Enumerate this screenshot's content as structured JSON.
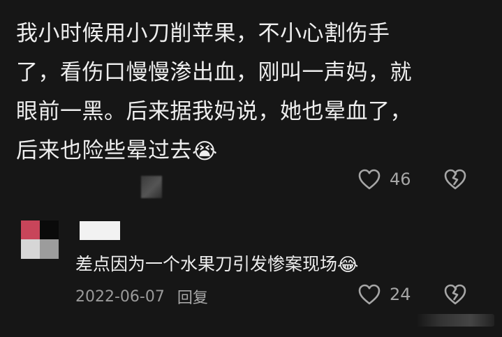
{
  "main_comment": {
    "lines": [
      "我小时候用小刀削苹果，不小心割伤手",
      "了，看伤口慢慢渗出血，刚叫一声妈，就",
      "眼前一黑。后来据我妈说，她也晕血了，",
      "后来也险些晕过去"
    ],
    "emoji": "😭",
    "like_count": "46"
  },
  "reply": {
    "text": "差点因为一个水果刀引发惨案现场",
    "emoji": "😂",
    "date": "2022-06-07",
    "reply_label": "回复",
    "like_count": "24"
  },
  "icons": {
    "like": "heart-outline-icon",
    "dislike": "broken-heart-outline-icon"
  },
  "colors": {
    "background": "#161616",
    "text": "#eeeeee",
    "secondary": "#9a9a9a"
  }
}
